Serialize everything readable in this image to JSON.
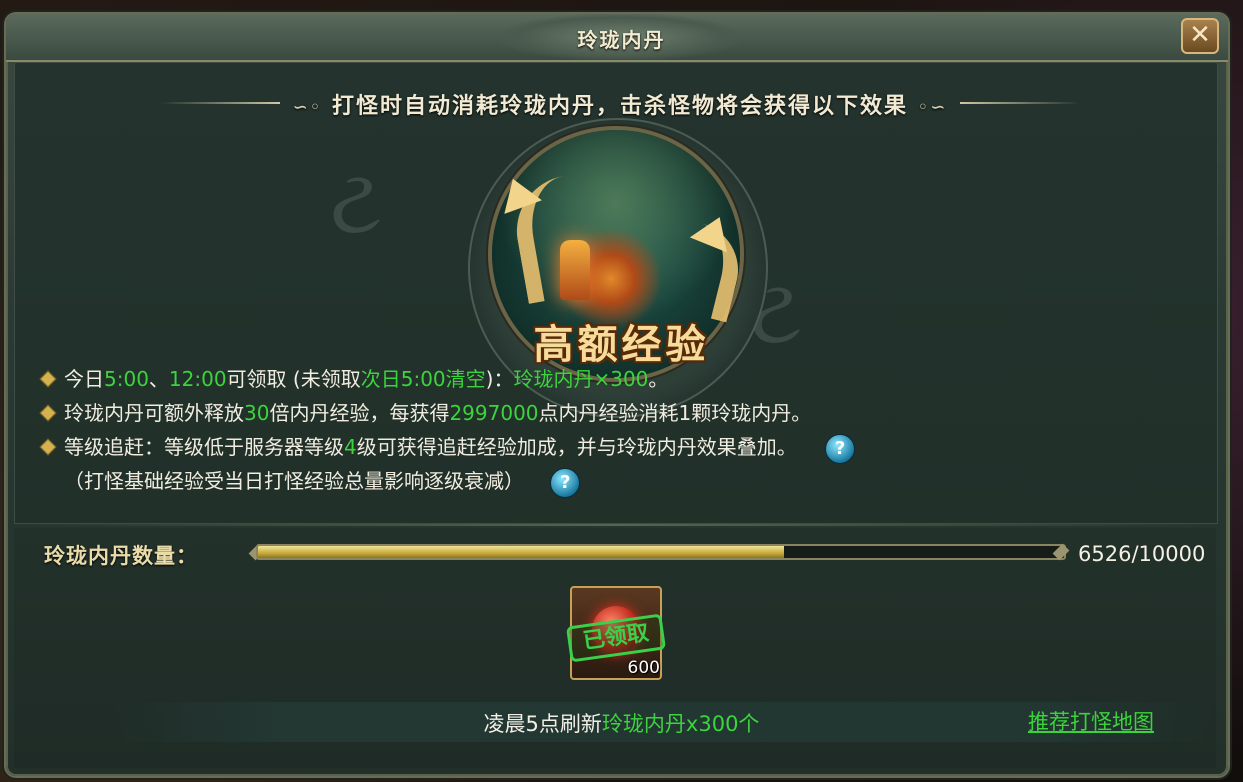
{
  "window": {
    "title": "玲珑内丹",
    "close_label": "✕"
  },
  "header": {
    "text": "打怪时自动消耗玲珑内丹，击杀怪物将会获得以下效果",
    "curl_left": "∽◦",
    "curl_right": "◦∽"
  },
  "banner": {
    "label": "高额经验"
  },
  "info": {
    "line1": {
      "p1": "今日",
      "t1": "5:00",
      "p2": "、",
      "t2": "12:00",
      "p3": "可领取 (未领取",
      "t3": "次日5:00清空",
      "p4": ")：",
      "t4": "玲珑内丹×300",
      "p5": "。"
    },
    "line2": {
      "p1": "玲珑内丹可额外释放",
      "t1": "30",
      "p2": "倍内丹经验，每获得",
      "t2": "2997000",
      "p3": "点内丹经验消耗1颗玲珑内丹。"
    },
    "line3": {
      "p1": "等级追赶：等级低于服务器等级",
      "t1": "4",
      "p2": "级可获得追赶经验加成，并与玲珑内丹效果叠加。"
    },
    "line4": "（打怪基础经验受当日打怪经验总量影响逐级衰减）",
    "help_label": "?"
  },
  "quantity": {
    "label": "玲珑内丹数量：",
    "current": 6526,
    "max": 10000,
    "display": "6526/10000",
    "fill_fraction": 0.6526
  },
  "reward_item": {
    "stamp": "已领取",
    "count": "600"
  },
  "footer": {
    "text_plain": "凌晨5点刷新",
    "text_green": "玲珑内丹x300个",
    "link": "推荐打怪地图"
  },
  "colors": {
    "highlight_green": "#3cd43c",
    "text_light": "#f1ede0",
    "gold": "#f6dc9a"
  }
}
